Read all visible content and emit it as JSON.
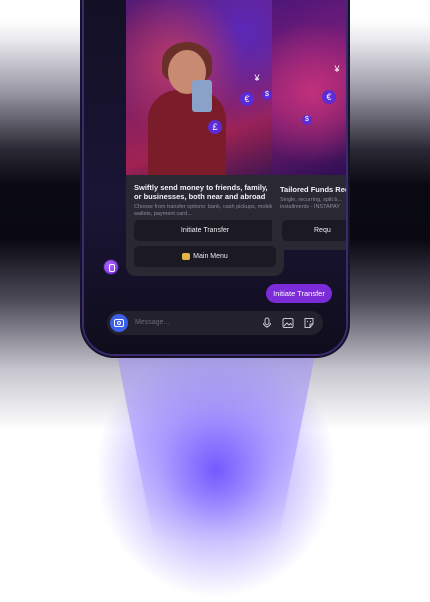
{
  "card_main": {
    "title": "Swiftly send money to friends, family, or businesses, both near and abroad",
    "description": "Choose from transfer options: bank, cash pickups, mobile wallets, payment card...",
    "button_primary": "Initiate Transfer",
    "button_secondary": "Main Menu",
    "icons": [
      "pound-icon",
      "euro-icon",
      "yen-icon",
      "dollar-icon"
    ]
  },
  "card_side": {
    "title": "Tailored Funds Req",
    "description": "Single, recurring, split b... installments - INSTAPAY",
    "button_primary": "Requ"
  },
  "chat": {
    "user_message": "Initiate Transfer"
  },
  "composer": {
    "placeholder": "Message..."
  },
  "colors": {
    "accent": "#7b2bd8",
    "camera": "#3b5fe8",
    "card": "#2a2833",
    "glow": "#6c50ff"
  }
}
